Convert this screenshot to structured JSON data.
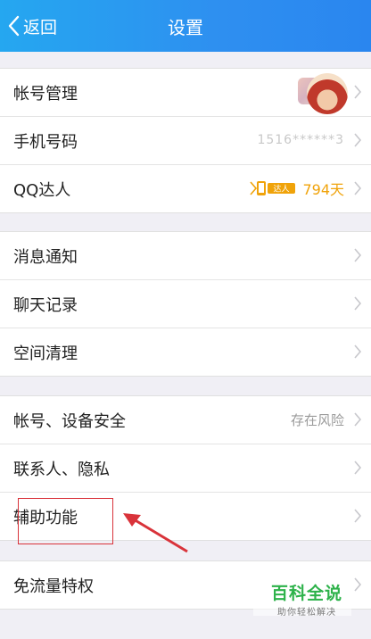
{
  "header": {
    "back_label": "返回",
    "title": "设置",
    "bg_color": "#2a8fef"
  },
  "group1": {
    "account_label": "帐号管理",
    "phone_label": "手机号码",
    "phone_value": "1516******3",
    "qq_label": "QQ达人",
    "qq_badge_text": "达人",
    "qq_days": "794天"
  },
  "group2": {
    "notify_label": "消息通知",
    "chat_label": "聊天记录",
    "space_label": "空间清理"
  },
  "group3": {
    "security_label": "帐号、设备安全",
    "security_value": "存在风险",
    "contacts_label": "联系人、隐私",
    "assist_label": "辅助功能"
  },
  "group4": {
    "free_label": "免流量特权"
  },
  "watermark": {
    "main": "百科全说",
    "sub": "助你轻松解决"
  },
  "colors": {
    "badge": "#f0a30a",
    "annotation": "#d9333a",
    "watermark": "#2db24a"
  }
}
